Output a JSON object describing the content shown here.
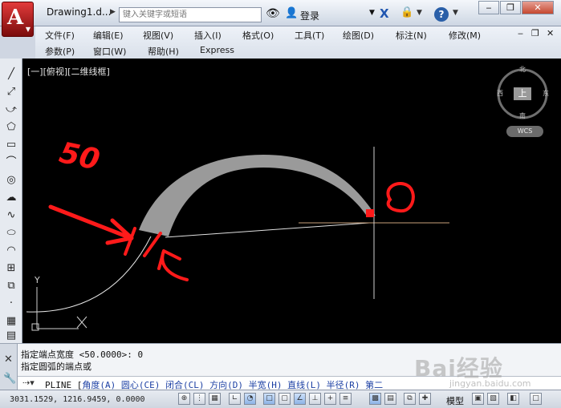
{
  "window": {
    "app_icon_letter": "A",
    "doc_title": "Drawing1.d...",
    "search_placeholder": "键入关键字或短语",
    "login_label": "登录"
  },
  "menu": {
    "row1": [
      "文件(F)",
      "编辑(E)",
      "视图(V)",
      "插入(I)",
      "格式(O)",
      "工具(T)",
      "绘图(D)",
      "标注(N)",
      "修改(M)"
    ],
    "row2": [
      "参数(P)",
      "窗口(W)",
      "帮助(H)",
      "Express"
    ]
  },
  "viewport": {
    "view_label": "[一][俯视][二维线框]",
    "compass": {
      "north": "北",
      "south": "南",
      "east": "东",
      "west": "西",
      "top": "上"
    },
    "wcs": "WCS",
    "ucs_y": "Y",
    "annotations": {
      "width_note": "50",
      "end_note": "0"
    }
  },
  "command": {
    "history_1": "指定端点宽度 <50.0000>: 0",
    "history_2": "指定圆弧的端点或",
    "current_command": "PLINE",
    "options": [
      "角度(A)",
      "圆心(CE)",
      "闭合(CL)",
      "方向(D)",
      "半宽(H)",
      "直线(L)",
      "半径(R)",
      "第二"
    ]
  },
  "status": {
    "coordinates": "3031.1529, 1216.9459, 0.0000",
    "model_label": "模型"
  },
  "watermark": {
    "text": "Bai经验",
    "sub": "jingyan.baidu.com"
  }
}
